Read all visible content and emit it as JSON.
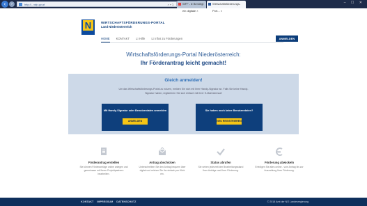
{
  "browser": {
    "address": "http://...wfp.gv.at",
    "tab1": "WFF - ● Benötigt ein digitale ×",
    "tab2": "Wirtschaftsförderungs-Port... ×"
  },
  "header": {
    "logo_letter": "N",
    "brand_line1": "WIRTSCHAFTSFÖRDERUNGS-PORTAL",
    "brand_line2": "Land Niederösterreich",
    "nav": [
      "HOME",
      "KONTAKT",
      "☑ Hilfe",
      "☑ Infos zu Förderungen"
    ],
    "login": "ANMELDEN"
  },
  "hero": {
    "line1": "Wirtschaftsförderungs-Portal Niederösterreich:",
    "line2": "Ihr Förderantrag leicht gemacht!"
  },
  "signin": {
    "title": "Gleich anmelden!",
    "text": "Um das Wirtschaftsförderungs-Portal zu nutzen, melden Sie sich mit Ihrer Handy-Signatur an. Falls Sie keine Handy-Signatur haben, registrieren Sie sich einfach mit Ihrer E-Mail Adresse!",
    "card1_title": "Mit Handy-Signatur oder Benutzerdaten anmelden",
    "card1_button": "ANMELDEN",
    "card2_title": "Sie haben noch keine Benutzerdaten?",
    "card2_button": "NEU REGISTRIEREN"
  },
  "features": [
    {
      "icon": "document-icon",
      "title": "Förderantrag erstellen",
      "desc": "Sie können Förderanträge online anlegen und gemeinsam mit Ihrem Projektpartnern bearbeiten."
    },
    {
      "icon": "send-icon",
      "title": "Antrag abschicken",
      "desc": "Unterschreiben Sie den Antrag bequem über digital und reichen Sie ihn einfach per Klick ein."
    },
    {
      "icon": "checkmark-icon",
      "title": "Status abrufen",
      "desc": "Sie sehen jederzeit den Bearbeitungsstand Ihrer Anträge und Ihrer Förderung."
    },
    {
      "icon": "euro-icon",
      "title": "Förderung abwickeln",
      "desc": "Erledigen Sie alles online - vom Antrag bis zur Auszahlung Ihrer Förderung."
    }
  ],
  "footer": {
    "links": [
      "KONTAKT",
      "IMPRESSUM",
      "DATENSCHUTZ"
    ],
    "copyright": "© 2018 Amt der NÖ Landesregierung"
  }
}
